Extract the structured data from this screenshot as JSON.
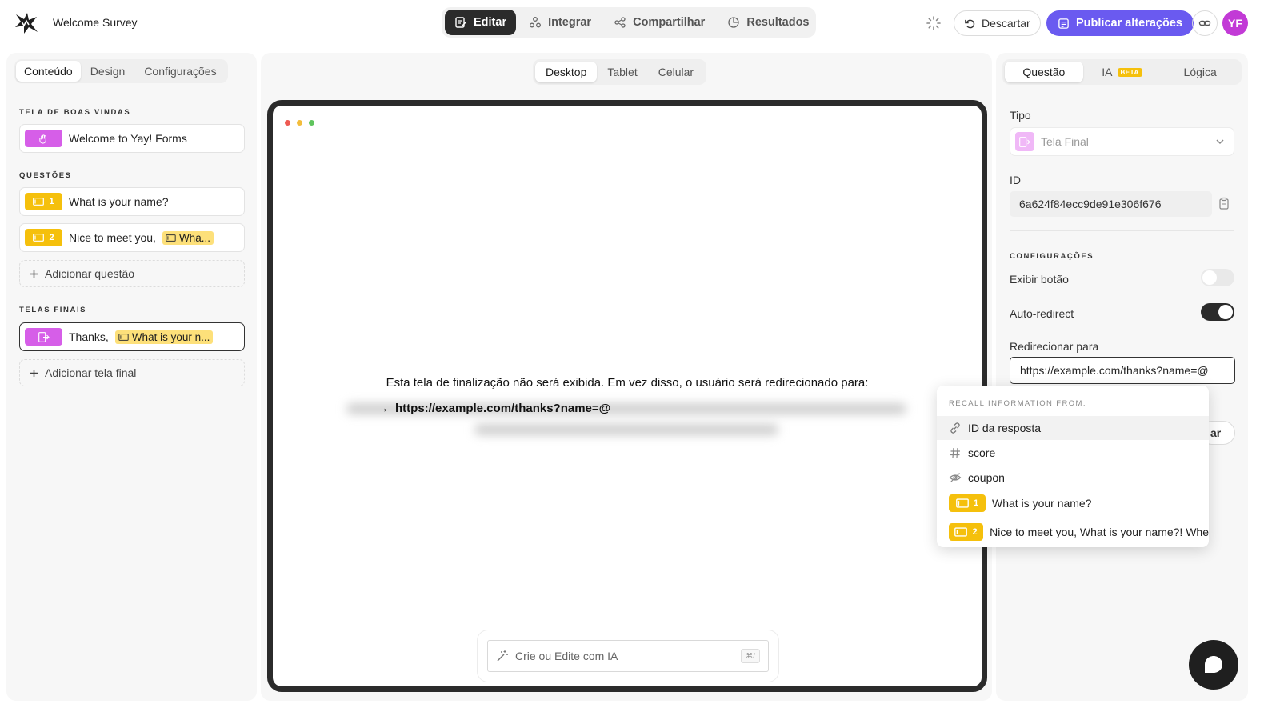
{
  "header": {
    "form_title": "Welcome Survey",
    "nav": [
      {
        "label": "Editar",
        "icon": "edit-icon",
        "active": true
      },
      {
        "label": "Integrar",
        "icon": "integrate-icon",
        "active": false
      },
      {
        "label": "Compartilhar",
        "icon": "share-icon",
        "active": false
      },
      {
        "label": "Resultados",
        "icon": "results-icon",
        "active": false
      }
    ],
    "discard_label": "Descartar",
    "publish_label": "Publicar alterações",
    "avatar_initials": "YF"
  },
  "left": {
    "tabs": [
      "Conteúdo",
      "Design",
      "Configurações"
    ],
    "active_tab": "Conteúdo",
    "welcome_section": "TELA DE BOAS VINDAS",
    "welcome_item": "Welcome to Yay! Forms",
    "questions_section": "QUESTÕES",
    "questions": [
      {
        "number": "1",
        "text": "What is your name?"
      },
      {
        "number": "2",
        "text": "Nice to meet you,",
        "chip": "Wha..."
      }
    ],
    "add_question": "Adicionar questão",
    "endings_section": "TELAS FINAIS",
    "ending_item": {
      "text": "Thanks,",
      "chip": "What is your n..."
    },
    "add_ending": "Adicionar tela final"
  },
  "center": {
    "devices": [
      "Desktop",
      "Tablet",
      "Celular"
    ],
    "active_device": "Desktop",
    "notice": "Esta tela de finalização não será exibida. Em vez disso, o usuário será redirecionado para:",
    "arrow": "→",
    "redirect_url": "https://example.com/thanks?name=@",
    "ai_placeholder": "Crie ou Edite com IA",
    "ai_shortcut": "⌘/"
  },
  "right": {
    "tabs": [
      "Questão",
      "IA",
      "Lógica"
    ],
    "beta_label": "BETA",
    "active_tab": "Questão",
    "type_label": "Tipo",
    "type_value": "Tela Final",
    "id_label": "ID",
    "id_value": "6a624f84ecc9de91e306f676",
    "settings_section": "CONFIGURAÇÕES",
    "show_button_label": "Exibir botão",
    "show_button_on": false,
    "auto_redirect_label": "Auto-redirect",
    "auto_redirect_on": true,
    "redirect_label": "Redirecionar para",
    "redirect_value": "https://example.com/thanks?name=@",
    "partial_button": "ar"
  },
  "recall": {
    "header": "RECALL INFORMATION FROM:",
    "items": [
      {
        "icon": "link-icon",
        "label": "ID da resposta",
        "highlight": true
      },
      {
        "icon": "hash-icon",
        "label": "score"
      },
      {
        "icon": "hidden-icon",
        "label": "coupon"
      },
      {
        "icon": "short-text-icon",
        "number": "1",
        "label": "What is your name?"
      },
      {
        "icon": "short-text-icon",
        "number": "2",
        "label": "Nice to meet you, What is your name?! Whe"
      }
    ]
  },
  "colors": {
    "accent": "#6a5af0",
    "avatar": "#c23ad6",
    "question_badge": "#f5c00c",
    "screen_badge": "#d65ee8",
    "recall_chip": "#fde07a"
  }
}
